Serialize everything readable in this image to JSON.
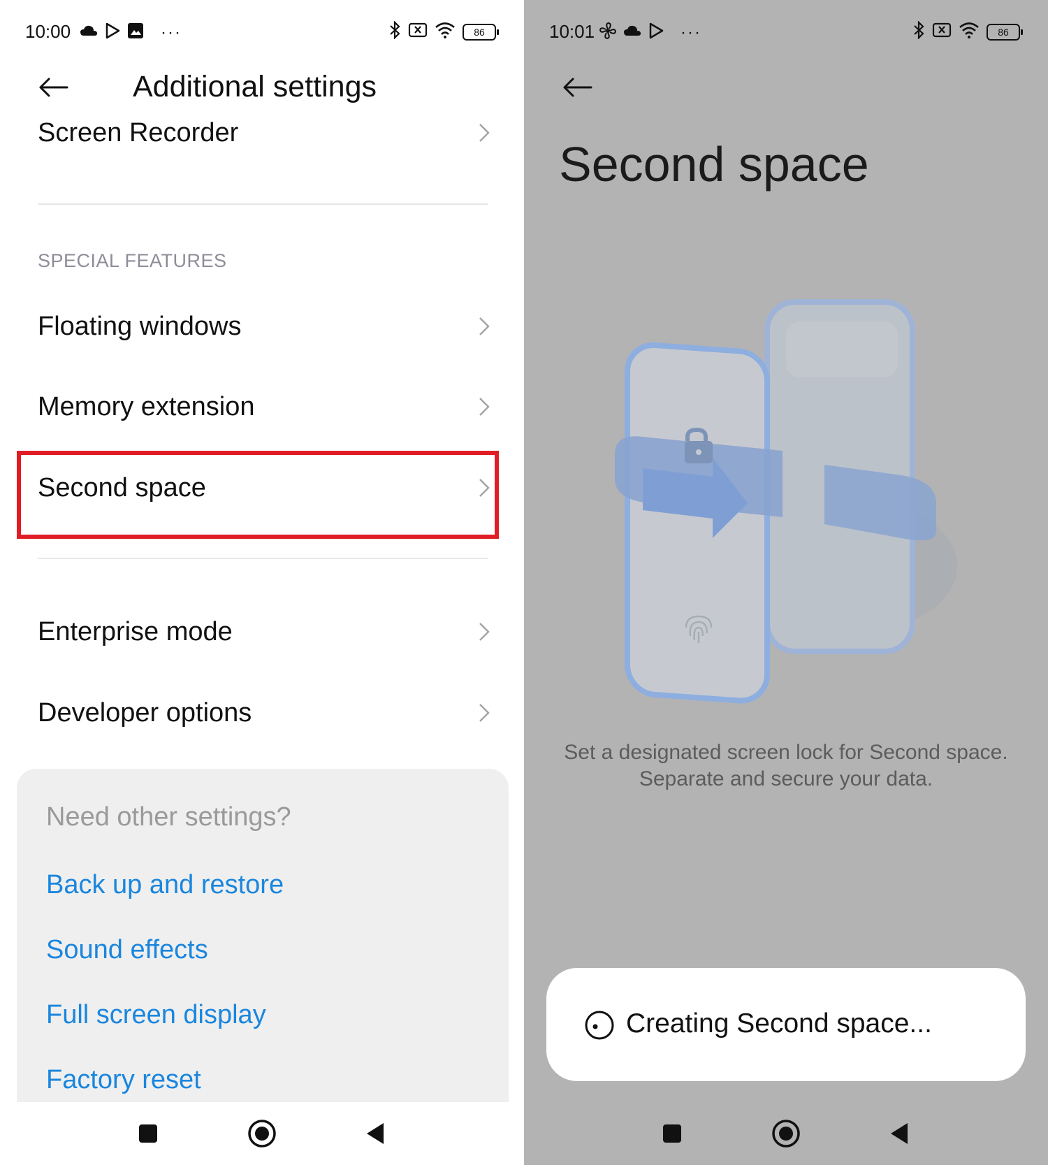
{
  "left": {
    "status": {
      "time": "10:00",
      "battery": "86"
    },
    "header": {
      "title": "Additional settings"
    },
    "rows": {
      "screen_recorder": "Screen Recorder",
      "floating_windows": "Floating windows",
      "memory_extension": "Memory extension",
      "second_space": "Second space",
      "enterprise_mode": "Enterprise mode",
      "developer_options": "Developer options"
    },
    "section_header": "SPECIAL FEATURES",
    "other": {
      "title": "Need other settings?",
      "links": [
        "Back up and restore",
        "Sound effects",
        "Full screen display",
        "Factory reset"
      ]
    },
    "highlight_color": "#e01d25",
    "link_color": "#1a86de"
  },
  "right": {
    "status": {
      "time": "10:01",
      "battery": "86"
    },
    "title": "Second space",
    "description": [
      "Set a designated screen lock for Second space.",
      "Separate and secure your data."
    ],
    "dialog": {
      "text": "Creating Second space..."
    },
    "background_color": "#b3b3b3"
  },
  "icons": [
    "back-arrow-icon",
    "chevron-right-icon",
    "cloud-icon",
    "play-store-icon",
    "bluetooth-icon",
    "wifi-icon",
    "battery-icon",
    "recents-icon",
    "home-icon",
    "back-icon",
    "lock-icon",
    "fingerprint-icon",
    "spinner-icon"
  ]
}
